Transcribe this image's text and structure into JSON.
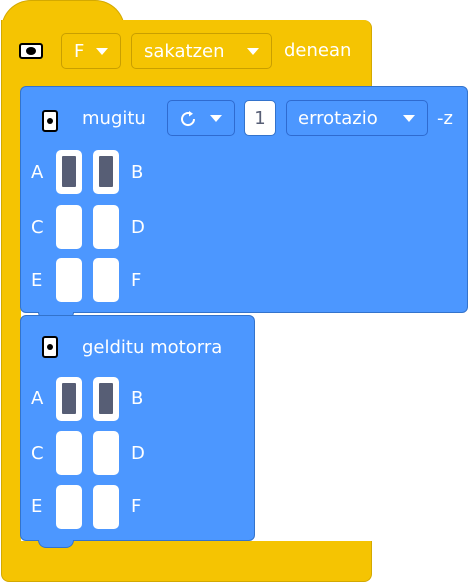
{
  "event_block": {
    "icon": "hub-icon",
    "button_value": "F",
    "action_value": "sakatzen",
    "suffix": "denean"
  },
  "move_block": {
    "icon": "motor-icon",
    "label": "mugitu",
    "direction_icon": "rotate-clockwise-icon",
    "amount": "1",
    "unit_value": "errotazio",
    "suffix": "-z",
    "ports": [
      {
        "left": "A",
        "right": "B",
        "left_selected": true,
        "right_selected": true
      },
      {
        "left": "C",
        "right": "D",
        "left_selected": false,
        "right_selected": false
      },
      {
        "left": "E",
        "right": "F",
        "left_selected": false,
        "right_selected": false
      }
    ]
  },
  "stop_block": {
    "icon": "motor-icon",
    "label": "gelditu motorra",
    "ports": [
      {
        "left": "A",
        "right": "B",
        "left_selected": true,
        "right_selected": true
      },
      {
        "left": "C",
        "right": "D",
        "left_selected": false,
        "right_selected": false
      },
      {
        "left": "E",
        "right": "F",
        "left_selected": false,
        "right_selected": false
      }
    ]
  },
  "colors": {
    "event_yellow": "#f5c402",
    "motor_blue": "#4c97ff",
    "selected_port": "#575e75"
  }
}
